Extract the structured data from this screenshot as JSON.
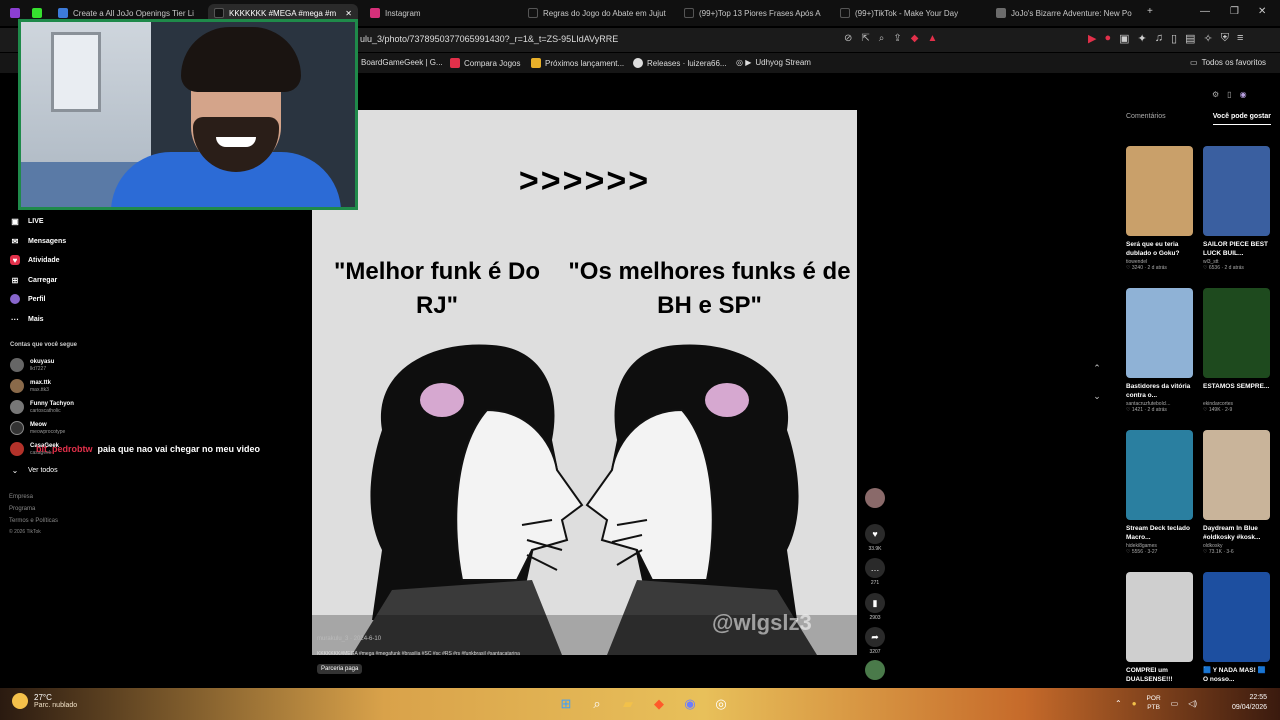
{
  "browser": {
    "tabs": [
      {
        "label": "Create a All JoJo Openings Tier Li"
      },
      {
        "label": "KKKKKKK #MEGA #mega #m"
      },
      {
        "label": "Instagram"
      },
      {
        "label": "Regras do Jogo do Abate em Jujut"
      },
      {
        "label": "(99+)Top 13 Piores Frases Após A"
      },
      {
        "label": "(99+)TikTok - Make Your Day"
      },
      {
        "label": "JoJo's Bizarre Adventure: New Po"
      }
    ],
    "url": "ulu_3/photo/7378950377065991430?_r=1&_t=ZS-95LIdAVyRRE",
    "bookmarks": [
      {
        "label": "BoardGameGeek | G..."
      },
      {
        "label": "Compara Jogos"
      },
      {
        "label": "Próximos lançament..."
      },
      {
        "label": "Releases · luizera66..."
      },
      {
        "label": "Udhyog Stream"
      }
    ],
    "all_bookmarks": "Todos os favoritos"
  },
  "nav": {
    "items": [
      {
        "label": "LIVE",
        "icon": "live-icon"
      },
      {
        "label": "Mensagens",
        "icon": "messages-icon"
      },
      {
        "label": "Atividade",
        "icon": "activity-icon"
      },
      {
        "label": "Carregar",
        "icon": "upload-icon"
      },
      {
        "label": "Perfil",
        "icon": "profile-icon"
      },
      {
        "label": "Mais",
        "icon": "more-icon"
      }
    ],
    "following_title": "Contas que você segue",
    "accounts": [
      {
        "name": "okuyasu",
        "handle": "lkt7227"
      },
      {
        "name": "max.ttk",
        "handle": "max.ttk3"
      },
      {
        "name": "Funny Tachyon",
        "handle": "cartoscatholic"
      },
      {
        "name": "Meow",
        "handle": "meowprocotype"
      },
      {
        "name": "CasaGeek",
        "handle": "casageek"
      }
    ],
    "see_all": "Ver todos",
    "footer": [
      "Empresa",
      "Programa",
      "Termos e Políticas",
      "© 2026 TikTok"
    ]
  },
  "chat": {
    "user": "bit_pedrobtw",
    "message": "paia que nao vai chegar no meu video"
  },
  "post": {
    "meme_arrows": ">>>>>>",
    "meme_left": "\"Melhor funk é Do RJ\"",
    "meme_right": "\"Os melhores funks é de BH e SP\"",
    "watermark": "@wlgslz3",
    "caption": "murakulu_3 · 2024-6-10",
    "tags": "KKKKKKK#MEGA #mega #megafunk #brasilia #SC #sc #RS #rs #funkbrasil #santacatarina",
    "badge": "Parceria paga",
    "likes": "33.9K",
    "comments": "271",
    "saves": "2903",
    "shares": "3207"
  },
  "right": {
    "tab_comments": "Comentários",
    "tab_foryou": "Você pode gostar",
    "cards": [
      {
        "title": "Será que eu teria dublado o Goku?",
        "author": "tiowendel",
        "stats": "♡ 3240 · 2 d atrás",
        "color": "#c9a06a"
      },
      {
        "title": "SAILOR PIECE BEST LUCK BUIL...",
        "author": "wl3_stt",
        "stats": "♡ 6536 · 2 d atrás",
        "color": "#3a5fa0"
      },
      {
        "title": "Bastidores da vitória contra o...",
        "author": "santacruzfutebolcl...",
        "stats": "♡ 1421 · 2 d atrás",
        "color": "#8fb2d6"
      },
      {
        "title": "ESTAMOS SEMPRE...",
        "author": "ekindarcortes",
        "stats": "♡ 149K · 2-9",
        "color": "#1e4a1e"
      },
      {
        "title": "Stream Deck teclado Macro...",
        "author": "hideki8games",
        "stats": "♡ 5556 · 3-27",
        "color": "#2a7fa0"
      },
      {
        "title": "Daydream In Blue #oldkosky #kosk...",
        "author": "oldkosky",
        "stats": "♡ 73.1K · 3-6",
        "color": "#c9b49a"
      },
      {
        "title": "COMPREI um DUALSENSE!!!",
        "author": "",
        "stats": "",
        "color": "#cfcfcf"
      },
      {
        "title": "🟦 Y NADA MAS! 🟦 O nosso...",
        "author": "",
        "stats": "",
        "color": "#1d4fa0"
      }
    ]
  },
  "taskbar": {
    "temp": "27°C",
    "cond": "Parc. nublado",
    "lang1": "POR",
    "lang2": "PTB",
    "time": "22:55",
    "date": "09/04/2026"
  },
  "colors": {
    "accent": "#fe2c55",
    "cam_border": "#1f8a4a"
  }
}
